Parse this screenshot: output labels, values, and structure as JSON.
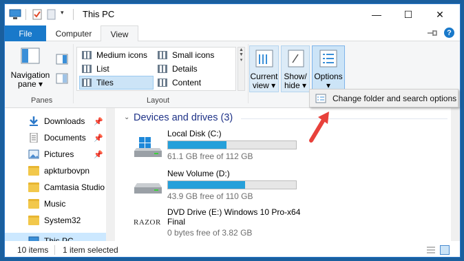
{
  "title": "This PC",
  "window_controls": {
    "minimize": "—",
    "maximize": "☐",
    "close": "✕"
  },
  "tabs": [
    {
      "label": "File"
    },
    {
      "label": "Computer"
    },
    {
      "label": "View"
    }
  ],
  "ribbon": {
    "pin_icon": "pin-icon",
    "help": "?",
    "panes": {
      "nav_pane": "Navigation",
      "nav_pane2": "pane",
      "group": "Panes"
    },
    "layout": {
      "items": [
        "Medium icons",
        "Small icons",
        "List",
        "Details",
        "Tiles",
        "Content"
      ],
      "selected": "Tiles",
      "group": "Layout"
    },
    "current_view": {
      "line1": "Current",
      "line2": "view"
    },
    "show_hide": {
      "line1": "Show/",
      "line2": "hide"
    },
    "options": {
      "label": "Options"
    }
  },
  "dropdown": {
    "text": "Change folder and search options"
  },
  "nav": {
    "items": [
      {
        "label": "Downloads",
        "pinned": true
      },
      {
        "label": "Documents",
        "pinned": true
      },
      {
        "label": "Pictures",
        "pinned": true
      },
      {
        "label": "apkturbovpn"
      },
      {
        "label": "Camtasia Studio"
      },
      {
        "label": "Music"
      },
      {
        "label": "System32"
      },
      {
        "label": "This PC"
      }
    ]
  },
  "content": {
    "section_title": "Devices and drives (3)",
    "drives": [
      {
        "name": "Local Disk (C:)",
        "free": "61.1 GB free of 112 GB",
        "used_fraction": 0.455
      },
      {
        "name": "New Volume (D:)",
        "free": "43.9 GB free of 110 GB",
        "used_fraction": 0.601
      },
      {
        "name": "DVD Drive (E:) Windows 10 Pro-x64",
        "name2": "Final",
        "free": "0 bytes free of 3.82 GB",
        "logo": "RAZOR"
      }
    ]
  },
  "status": {
    "items": "10 items",
    "selected": "1 item selected"
  },
  "colors": {
    "accent": "#1979ca",
    "bar": "#26a0da",
    "annotation_arrow": "#e8413b"
  }
}
